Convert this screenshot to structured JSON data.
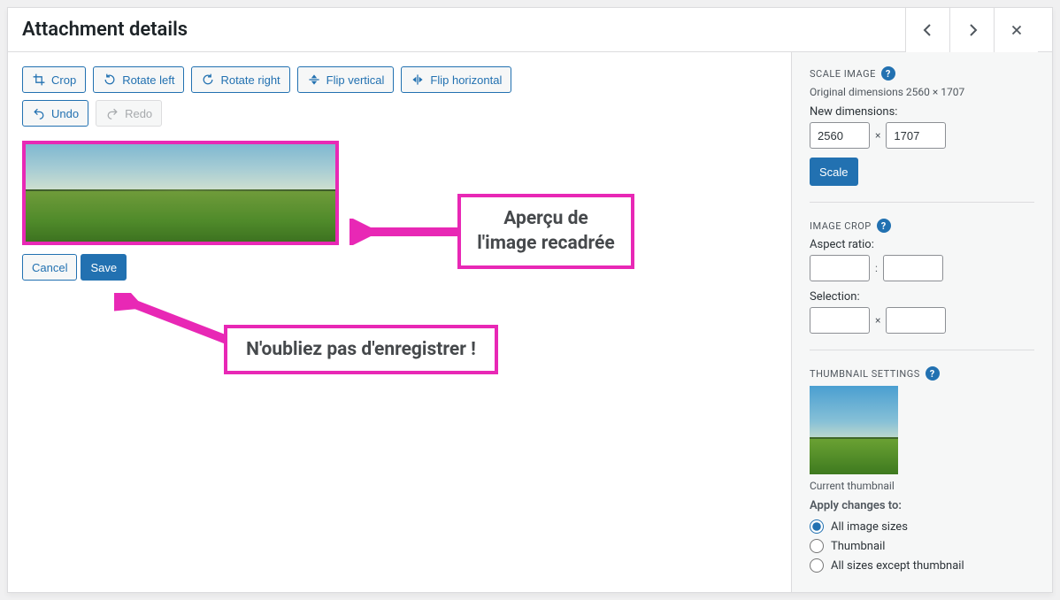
{
  "header": {
    "title": "Attachment details"
  },
  "toolbar": {
    "crop": "Crop",
    "rotate_left": "Rotate left",
    "rotate_right": "Rotate right",
    "flip_vertical": "Flip vertical",
    "flip_horizontal": "Flip horizontal",
    "undo": "Undo",
    "redo": "Redo"
  },
  "actions": {
    "cancel": "Cancel",
    "save": "Save"
  },
  "callouts": {
    "preview": "Aperçu de l'image recadrée",
    "save": "N'oubliez pas d'enregistrer !"
  },
  "sidebar": {
    "scale": {
      "title": "SCALE IMAGE",
      "original_label": "Original dimensions 2560 × 1707",
      "new_label": "New dimensions:",
      "width": "2560",
      "height": "1707",
      "button": "Scale",
      "times": "×"
    },
    "crop": {
      "title": "IMAGE CROP",
      "aspect_label": "Aspect ratio:",
      "aspect_sep": ":",
      "selection_label": "Selection:",
      "selection_sep": "×"
    },
    "thumb": {
      "title": "THUMBNAIL SETTINGS",
      "current": "Current thumbnail",
      "apply_label": "Apply changes to:",
      "opt_all": "All image sizes",
      "opt_thumb": "Thumbnail",
      "opt_except": "All sizes except thumbnail"
    }
  }
}
